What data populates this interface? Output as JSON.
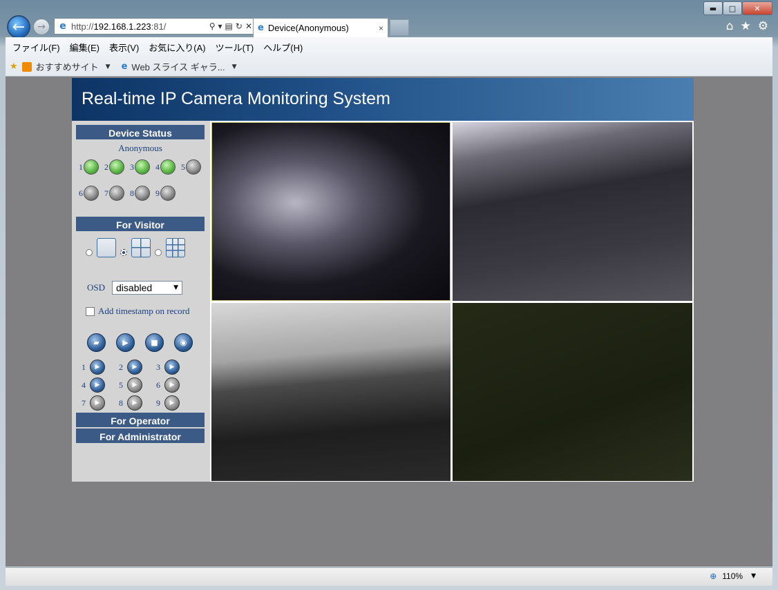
{
  "browser": {
    "address_scheme": "http://",
    "address_host": "192.168.1.223",
    "address_port": ":81/",
    "tab_title": "Device(Anonymous)",
    "tab_close": "×",
    "back_glyph": "←",
    "forward_glyph": "→",
    "menu": [
      "ファイル(F)",
      "編集(E)",
      "表示(V)",
      "お気に入り(A)",
      "ツール(T)",
      "ヘルプ(H)"
    ],
    "favorites": {
      "item1": "おすすめサイト",
      "item2": "Web スライス ギャラ..."
    },
    "zoom": "110%",
    "icons": [
      "home-icon",
      "favorites-star-icon",
      "settings-gear-icon",
      "search-icon",
      "refresh-icon",
      "stop-icon"
    ]
  },
  "window": {
    "minimize": "▬",
    "maximize": "□",
    "close": "✕"
  },
  "app": {
    "title": "Real-time IP Camera Monitoring System",
    "device_status": {
      "header": "Device Status",
      "device_name": "Anonymous",
      "channels": [
        {
          "num": "1",
          "on": true
        },
        {
          "num": "2",
          "on": true
        },
        {
          "num": "3",
          "on": true
        },
        {
          "num": "4",
          "on": true
        },
        {
          "num": "5",
          "on": false
        },
        {
          "num": "6",
          "on": false
        },
        {
          "num": "7",
          "on": false
        },
        {
          "num": "8",
          "on": false
        },
        {
          "num": "9",
          "on": false
        }
      ]
    },
    "visitor": {
      "header": "For Visitor",
      "layouts": [
        "single-view",
        "quad-view",
        "nine-view"
      ],
      "selected_layout": "quad-view",
      "osd_label": "OSD",
      "osd_value": "disabled",
      "timestamp_label": "Add timestamp on record",
      "timestamp_checked": false,
      "controls": [
        "open-folder-icon",
        "play-icon",
        "stop-icon",
        "snapshot-camera-icon"
      ],
      "record_channels": [
        {
          "num": "1",
          "active": true
        },
        {
          "num": "2",
          "active": true
        },
        {
          "num": "3",
          "active": true
        },
        {
          "num": "4",
          "active": true
        },
        {
          "num": "5",
          "active": false
        },
        {
          "num": "6",
          "active": false
        },
        {
          "num": "7",
          "active": false
        },
        {
          "num": "8",
          "active": false
        },
        {
          "num": "9",
          "active": false
        }
      ]
    },
    "operator_header": "For Operator",
    "administrator_header": "For Administrator"
  }
}
